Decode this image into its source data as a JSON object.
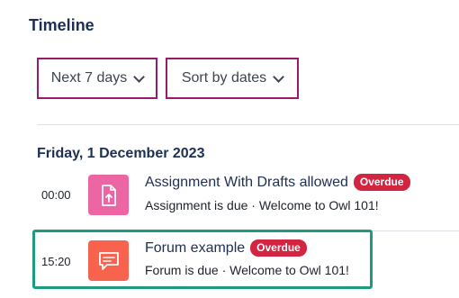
{
  "header": {
    "title": "Timeline"
  },
  "filters": {
    "days_label": "Next 7 days",
    "sort_label": "Sort by dates"
  },
  "date_group": {
    "heading": "Friday, 1 December 2023"
  },
  "events": [
    {
      "time": "00:00",
      "icon": "assignment-upload-icon",
      "title": "Assignment With Drafts allowed",
      "badge": "Overdue",
      "subtitle": "Assignment is due · Welcome to Owl 101!"
    },
    {
      "time": "15:20",
      "icon": "forum-chat-icon",
      "title": "Forum example",
      "badge": "Overdue",
      "subtitle": "Forum is due · Welcome to Owl 101!"
    }
  ],
  "colors": {
    "heading": "#1d2f53",
    "filter_border": "#9a1a6b",
    "assign_icon_bg": "#eb66a2",
    "forum_icon_bg": "#f7634d",
    "overdue_badge": "#d32442",
    "highlight_border": "#1c9b80"
  }
}
